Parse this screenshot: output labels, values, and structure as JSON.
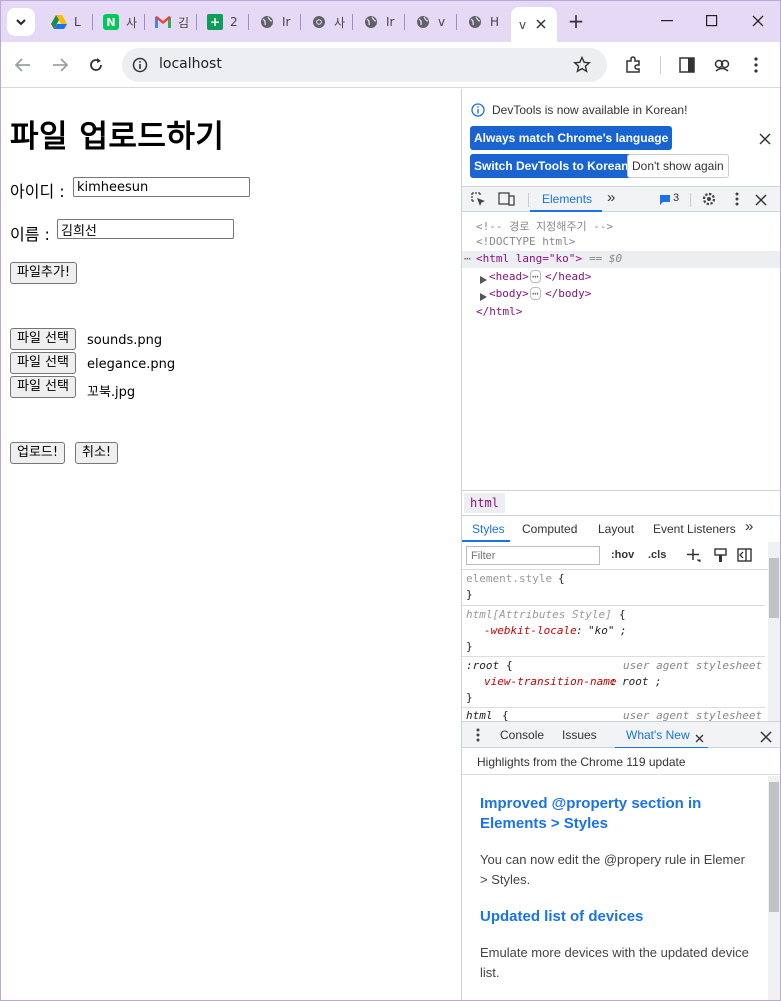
{
  "browser": {
    "tabs": [
      {
        "label": "L",
        "icon": "google-drive-icon"
      },
      {
        "label": "사",
        "icon": "naver-icon"
      },
      {
        "label": "김",
        "icon": "gmail-icon"
      },
      {
        "label": "2",
        "icon": "sheets-icon"
      },
      {
        "label": "Ir",
        "icon": "globe-icon"
      },
      {
        "label": "사",
        "icon": "chrome-icon"
      },
      {
        "label": "Ir",
        "icon": "globe-icon"
      },
      {
        "label": "v",
        "icon": "globe-icon"
      },
      {
        "label": "H",
        "icon": "globe-icon"
      },
      {
        "label": "v",
        "icon": "page-icon"
      }
    ],
    "active_tab_index": 9,
    "new_tab_symbol": "+",
    "url": "localhost"
  },
  "page": {
    "title": "파일 업로드하기",
    "id_label": "아이디 :",
    "id_value": "kimheesun",
    "name_label": "이름 :",
    "name_value": "김희선",
    "add_file_button": "파일추가!",
    "file_inputs": [
      {
        "button": "파일 선택",
        "filename": "sounds.png"
      },
      {
        "button": "파일 선택",
        "filename": "elegance.png"
      },
      {
        "button": "파일 선택",
        "filename": "꼬북.jpg"
      }
    ],
    "upload_button": "업로드!",
    "cancel_button": "취소!"
  },
  "devtools": {
    "info_text": "DevTools is now available in Korean!",
    "always_match_button": "Always match Chrome's language",
    "switch_button": "Switch DevTools to Korean",
    "dont_show_button": "Don't show again",
    "main_tabs": {
      "elements": "Elements",
      "more": "»",
      "issues_count": "3"
    },
    "dom": {
      "comment": "<!-- 경로 지정해주기 -->",
      "doctype": "<!DOCTYPE html>",
      "html_open_tag": "<html lang=\"ko\">",
      "html_selected_marker": "== $0",
      "head": "<head>",
      "head_close": "</head>",
      "body": "<body>",
      "body_close": "</body>",
      "html_close": "</html>",
      "ellipsis": "⋯"
    },
    "breadcrumb": "html",
    "styles_tabs": [
      "Styles",
      "Computed",
      "Layout",
      "Event Listeners"
    ],
    "filter_placeholder": "Filter",
    "filter_hov": ":hov",
    "filter_cls": ".cls",
    "rules": {
      "r1_selector": "element.style",
      "r2_selector": "html[Attributes Style]",
      "r2_prop": "-webkit-locale",
      "r2_value": "\"ko\"",
      "r3_selector": ":root",
      "r3_source": "user agent stylesheet",
      "r3_prop": "view-transition-name",
      "r3_value": "root",
      "r4_selector": "html",
      "r4_source": "user agent stylesheet",
      "open_brace": "{",
      "close_brace": "}"
    },
    "drawer_tabs": [
      "Console",
      "Issues",
      "What's New"
    ],
    "whats_new": {
      "highlights": "Highlights from the Chrome 119 update",
      "h1_line1": "Improved @property section in",
      "h1_line2": "Elements > Styles",
      "p1_line1": "You can now edit the @propery rule in Elemer",
      "p1_line2": "> Styles.",
      "h2": "Updated list of devices",
      "p2_line1": "Emulate more devices with the updated device",
      "p2_line2": "list."
    }
  }
}
